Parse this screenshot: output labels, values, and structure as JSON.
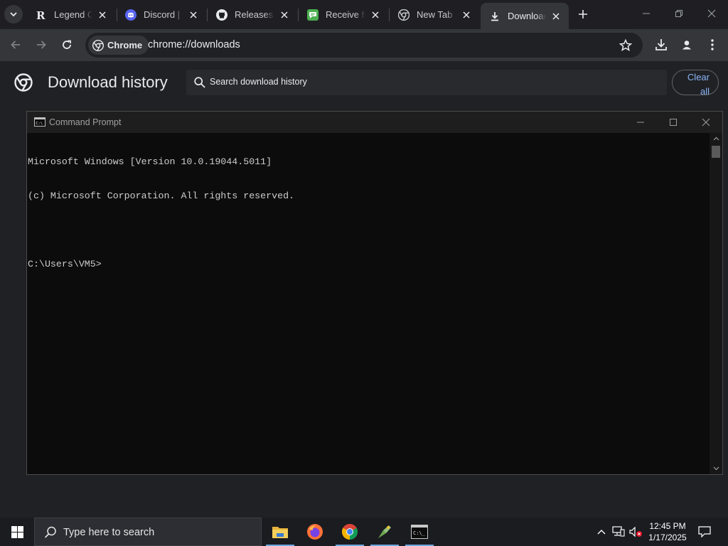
{
  "tabs": [
    {
      "title": "Legend Of",
      "icon": "r-logo-icon"
    },
    {
      "title": "Discord | P",
      "icon": "discord-icon"
    },
    {
      "title": "Releases ·",
      "icon": "github-icon"
    },
    {
      "title": "Receive fre",
      "icon": "sms-icon"
    },
    {
      "title": "New Tab",
      "icon": "chrome-icon"
    },
    {
      "title": "Downloads",
      "icon": "download-icon"
    }
  ],
  "toolbar": {
    "chip_label": "Chrome",
    "url": "chrome://downloads"
  },
  "downloads": {
    "title": "Download history",
    "search_placeholder": "Search download history",
    "clear_all_label": "Clear all"
  },
  "cmd": {
    "title": "Command Prompt",
    "lines": [
      "Microsoft Windows [Version 10.0.19044.5011]",
      "(c) Microsoft Corporation. All rights reserved.",
      "",
      "C:\\Users\\VM5>"
    ]
  },
  "taskbar": {
    "search_placeholder": "Type here to search",
    "apps": [
      "file-explorer-icon",
      "firefox-icon",
      "chrome-icon",
      "app-icon",
      "command-prompt-icon"
    ],
    "time": "12:45 PM",
    "date": "1/17/2025"
  },
  "colors": {
    "tab_strip": "#1f1f23",
    "toolbar": "#35363a",
    "page_bg": "#202124",
    "accent_blue": "#8ab4f8",
    "console_bg": "#0c0c0c",
    "console_text": "#cccccc"
  }
}
